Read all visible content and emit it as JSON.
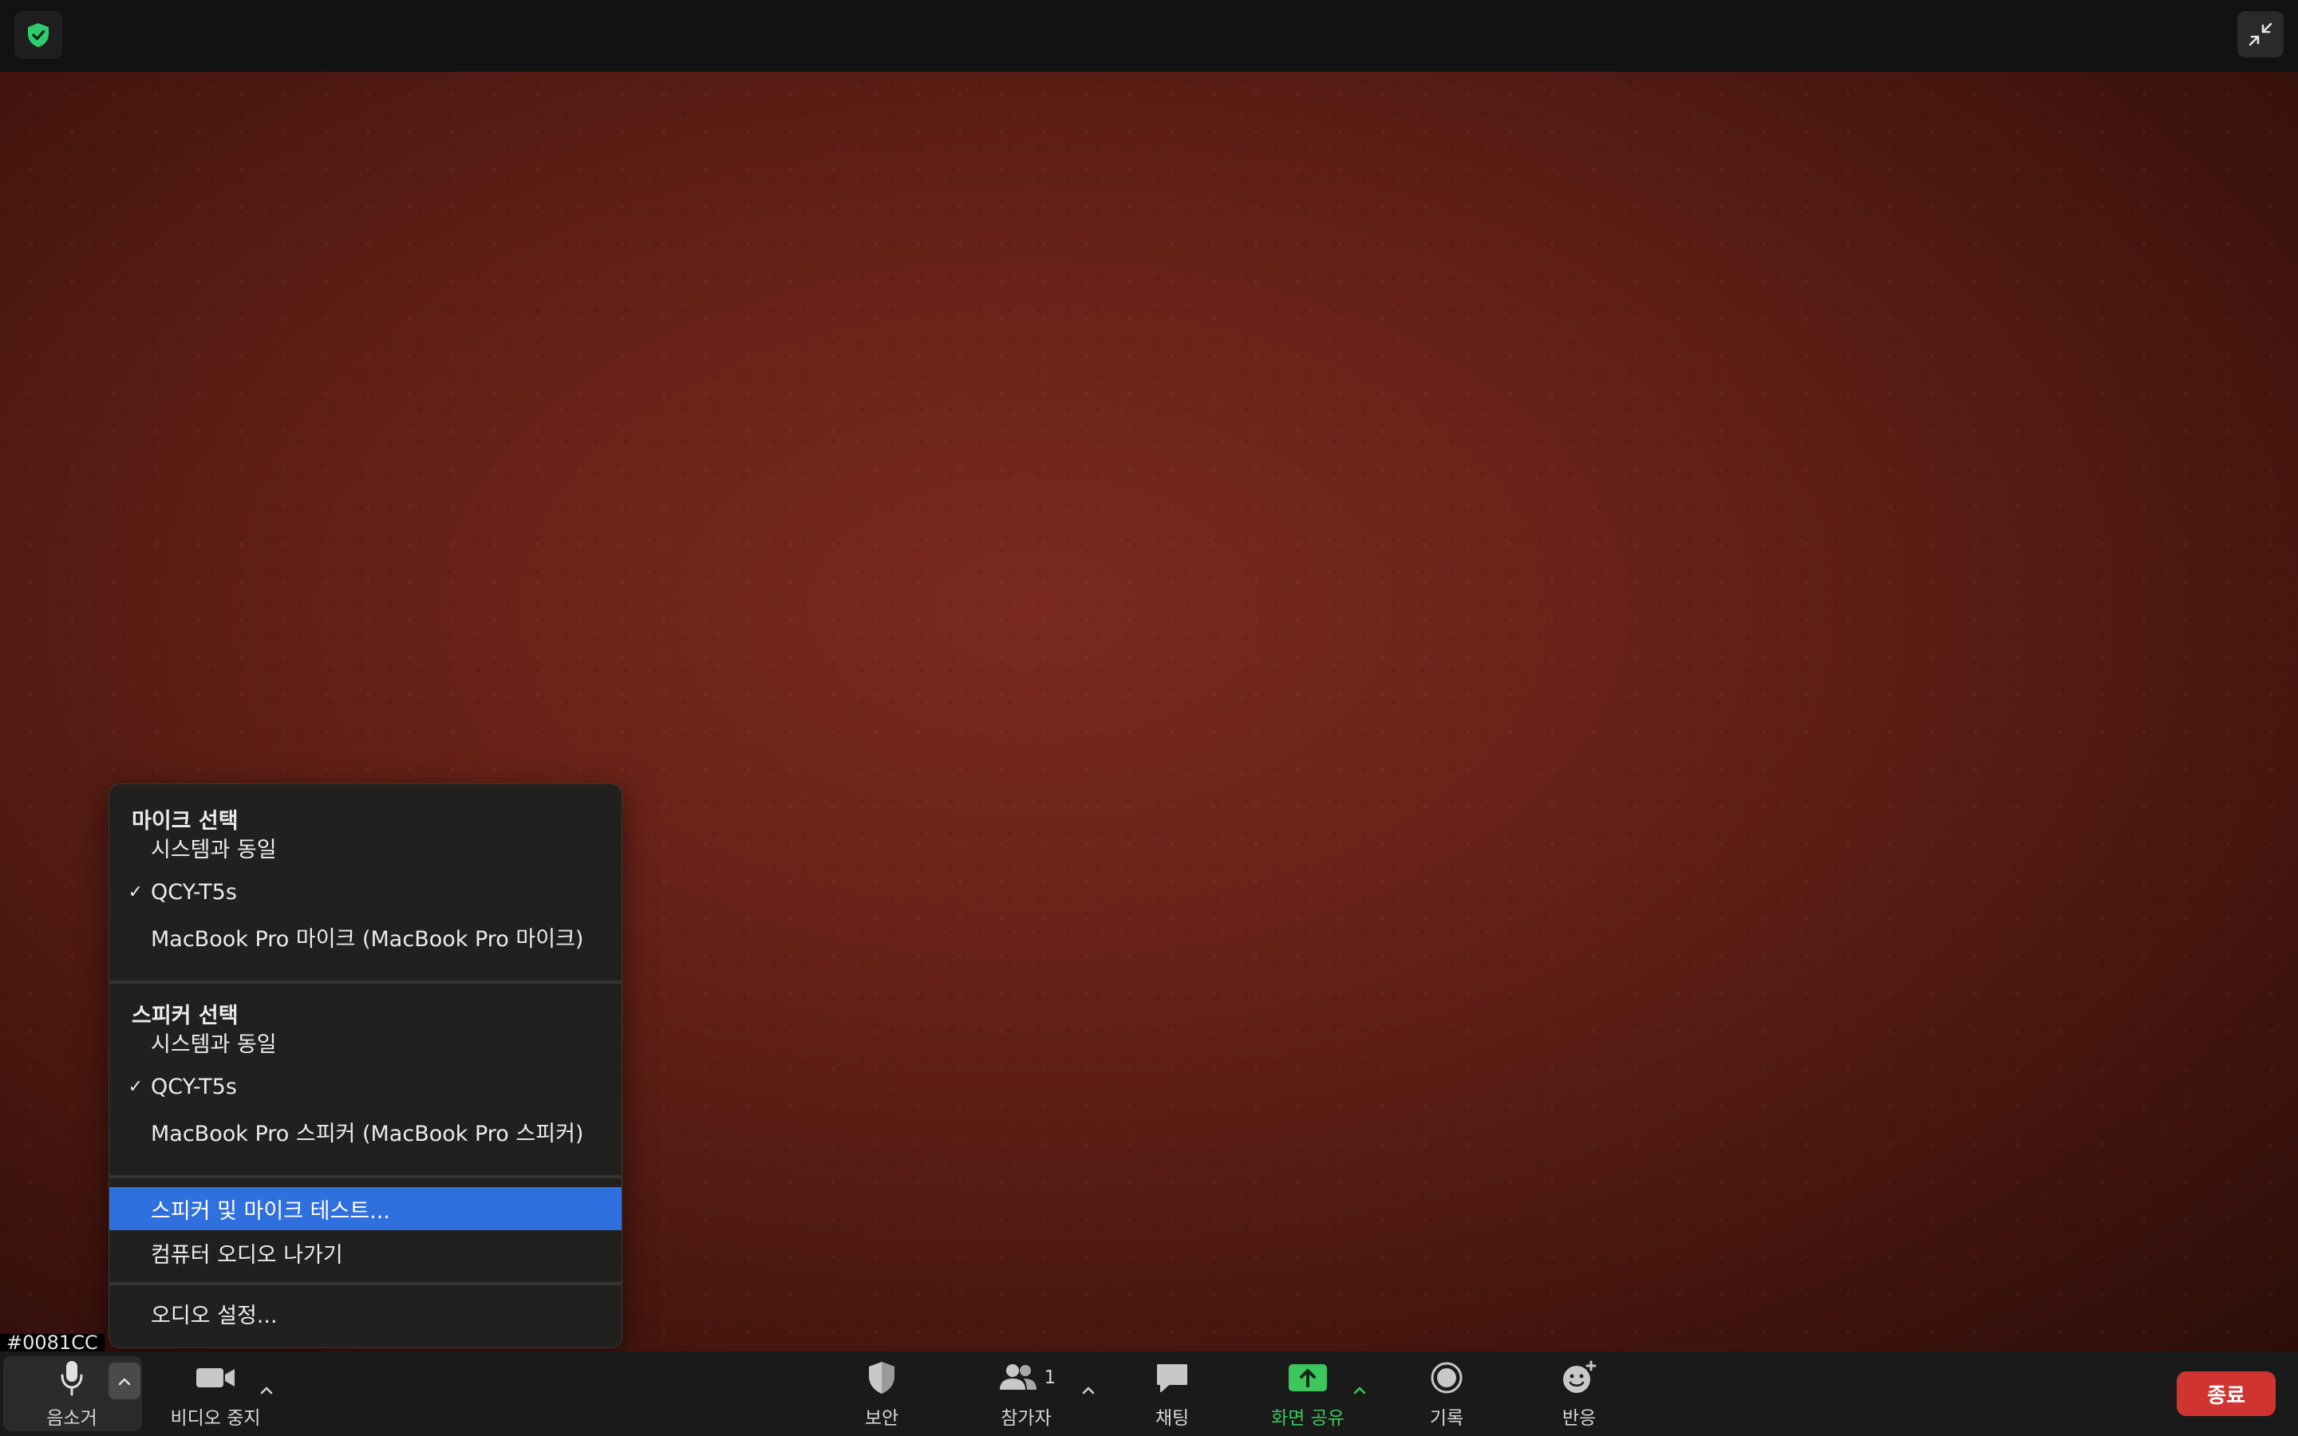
{
  "meeting_id_tag": "#0081CC",
  "audio_menu": {
    "mic_section": {
      "header": "마이크 선택",
      "items": [
        {
          "label": "시스템과 동일",
          "checked": false
        },
        {
          "label": "QCY-T5s",
          "checked": true
        },
        {
          "label": "MacBook Pro 마이크 (MacBook Pro 마이크)",
          "checked": false
        }
      ]
    },
    "speaker_section": {
      "header": "스피커 선택",
      "items": [
        {
          "label": "시스템과 동일",
          "checked": false
        },
        {
          "label": "QCY-T5s",
          "checked": true
        },
        {
          "label": "MacBook Pro 스피커 (MacBook Pro 스피커)",
          "checked": false
        }
      ]
    },
    "test_label": "스피커 및 마이크 테스트...",
    "leave_audio_label": "컴퓨터 오디오 나가기",
    "audio_settings_label": "오디오 설정...",
    "check_glyph": "✓"
  },
  "toolbar": {
    "mute_label": "음소거",
    "video_label": "비디오 중지",
    "security_label": "보안",
    "participants_label": "참가자",
    "participants_count": "1",
    "chat_label": "채팅",
    "share_label": "화면 공유",
    "record_label": "기록",
    "reactions_label": "반응",
    "end_label": "종료",
    "caret_glyph": "^"
  },
  "colors": {
    "share_green": "#3dc65b",
    "end_red": "#d03431",
    "highlight_blue": "#2f6fde",
    "shield_green": "#2ecc71"
  },
  "icons": {
    "top_left": "shield-check-icon",
    "top_right": "exit-fullscreen-icon"
  }
}
